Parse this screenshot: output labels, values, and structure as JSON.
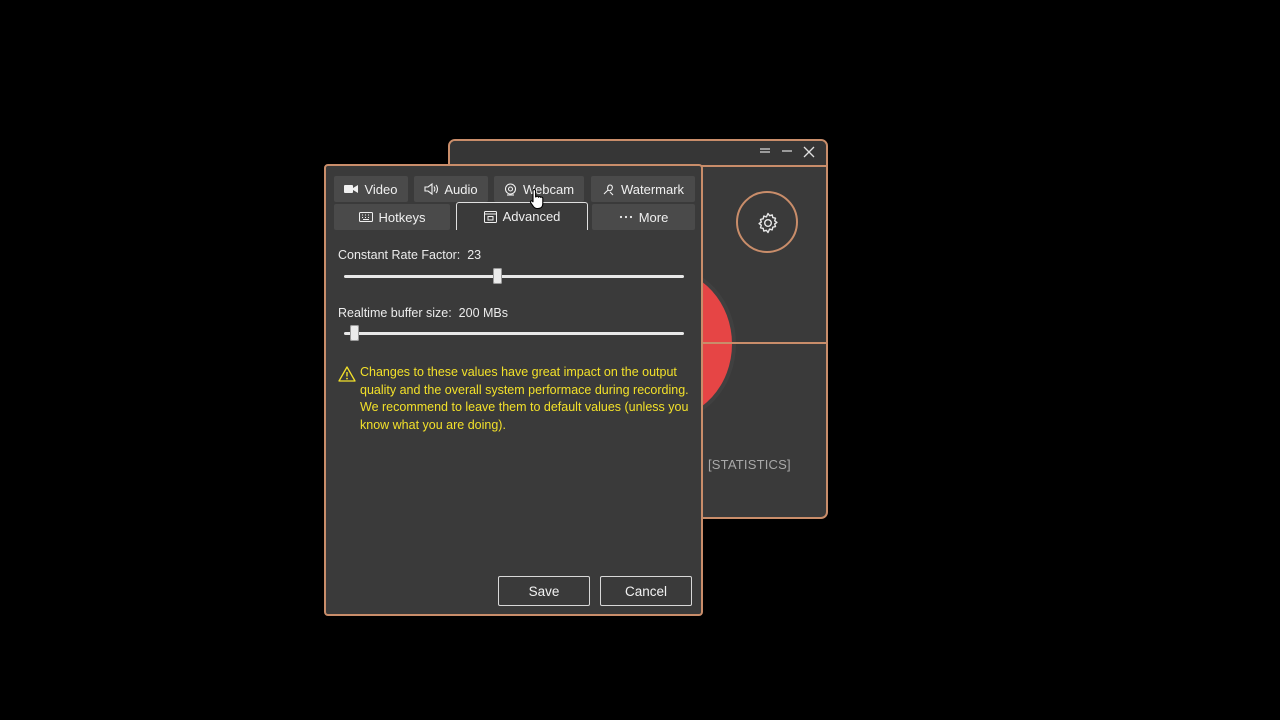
{
  "main_window": {
    "stats_label": "[STATISTICS]",
    "icons": [
      "menu-icon",
      "minimize-icon",
      "close-icon",
      "gear-icon"
    ]
  },
  "dialog": {
    "tabs_row1": [
      {
        "label": "Video",
        "icon": "video-camera-icon"
      },
      {
        "label": "Audio",
        "icon": "speaker-icon"
      },
      {
        "label": "Webcam",
        "icon": "webcam-icon"
      },
      {
        "label": "Watermark",
        "icon": "watermark-icon"
      }
    ],
    "tabs_row2": [
      {
        "label": "Hotkeys",
        "icon": "keyboard-icon"
      },
      {
        "label": "Advanced",
        "icon": "advanced-icon",
        "active": true
      },
      {
        "label": "More",
        "icon": "ellipsis-icon"
      }
    ],
    "crf": {
      "label": "Constant Rate Factor:",
      "value": "23",
      "level_fraction": 0.45
    },
    "buffer": {
      "label": "Realtime buffer size:",
      "value": "200 MBs",
      "level_fraction": 0.03
    },
    "warning": "Changes to these values have great impact on the output quality and the overall system performace during recording. We recommend to leave them to default values (unless you know what you are doing).",
    "save_label": "Save",
    "cancel_label": "Cancel"
  },
  "colors": {
    "accent_border": "#c98d6a",
    "record": "#e64545",
    "warning_text": "#f2e02a",
    "panel_bg": "#3a3a3a"
  }
}
